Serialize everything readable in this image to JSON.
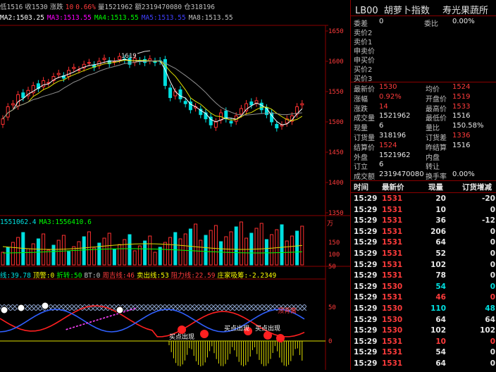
{
  "top_bar": {
    "fragments": [
      {
        "text": "低1516",
        "color": "#c0c0c0"
      },
      {
        "text": "收1530",
        "color": "#c0c0c0"
      },
      {
        "text": "涨跌",
        "color": "#c0c0c0"
      },
      {
        "text": "10",
        "color": "#ff3b3b"
      },
      {
        "text": "0.66%",
        "color": "#ff3b3b"
      },
      {
        "text": "量1521962",
        "color": "#c0c0c0"
      },
      {
        "text": "额2319470080",
        "color": "#c0c0c0"
      },
      {
        "text": "仓318196",
        "color": "#c0c0c0"
      }
    ]
  },
  "ma_line": {
    "fragments": [
      {
        "text": "MA2:1503.25",
        "color": "#ffffff"
      },
      {
        "text": "MA3:1513.55",
        "color": "#ff00ff"
      },
      {
        "text": "MA4:1513.55",
        "color": "#00ff00"
      },
      {
        "text": "MA5:1513.55",
        "color": "#4040ff"
      },
      {
        "text": "MA8:1513.55",
        "color": "#c0c0c0"
      }
    ]
  },
  "price_axis": [
    "1650",
    "1600",
    "1550",
    "1500",
    "1450",
    "1400",
    "1350"
  ],
  "peak_label": "1619",
  "volume_bar": {
    "fragments": [
      {
        "text": "1551062.4",
        "color": "#00e0e0"
      },
      {
        "text": "MA3:1556410.6",
        "color": "#00ff00"
      }
    ]
  },
  "volume_axis": [
    "150",
    "100",
    "50"
  ],
  "volume_unit": "万",
  "indicator_bar": {
    "fragments": [
      {
        "text": "线:39.78",
        "color": "#00e0e0"
      },
      {
        "text": "顶警:0",
        "color": "#ffff00"
      },
      {
        "text": "折转:50",
        "color": "#00ff00"
      },
      {
        "text": "BT:0",
        "color": "#c0c0c0"
      },
      {
        "text": "周吉线:46",
        "color": "#ff3b3b"
      },
      {
        "text": "卖出线:53",
        "color": "#ffff00"
      },
      {
        "text": "阻力线:22.59",
        "color": "#ff3b3b"
      },
      {
        "text": "庄家吸筹:-2.2349",
        "color": "#ffff00"
      }
    ]
  },
  "indicator_axis": [
    "50",
    "0"
  ],
  "annotations": {
    "sell_top": "顶背离",
    "buy_1": "买点出现",
    "buy_2": "买点出现",
    "buy_3": "买点出现"
  },
  "right_panel": {
    "code": "LB00",
    "name": "胡萝卜指数",
    "sub": "寿光果蔬所",
    "book": [
      {
        "label": "委差",
        "value": "0",
        "label2": "委比",
        "value2": "0.00%"
      },
      {
        "label": "卖价2",
        "value": ""
      },
      {
        "label": "卖价1",
        "value": ""
      },
      {
        "label": "申卖价",
        "value": ""
      },
      {
        "label": "申买价",
        "value": ""
      },
      {
        "label": "买价2",
        "value": ""
      },
      {
        "label": "买价3",
        "value": ""
      }
    ],
    "quote": [
      {
        "l1": "最新价",
        "v1": "1530",
        "c1": "red",
        "l2": "均价",
        "v2": "1524",
        "c2": "red"
      },
      {
        "l1": "涨幅",
        "v1": "0.92%",
        "c1": "red",
        "l2": "开盘价",
        "v2": "1519",
        "c2": "red"
      },
      {
        "l1": "涨跌",
        "v1": "14",
        "c1": "red",
        "l2": "最高价",
        "v2": "1533",
        "c2": "red"
      },
      {
        "l1": "成交量",
        "v1": "1521962",
        "c1": "white",
        "l2": "最低价",
        "v2": "1516",
        "c2": "white"
      },
      {
        "l1": "现量",
        "v1": "6",
        "c1": "white",
        "l2": "量比",
        "v2": "150.58%",
        "c2": "white"
      },
      {
        "l1": "订货量",
        "v1": "318196",
        "c1": "white",
        "l2": "订货差",
        "v2": "1336",
        "c2": "red"
      },
      {
        "l1": "结算价",
        "v1": "1524",
        "c1": "red",
        "l2": "昨结算",
        "v2": "1516",
        "c2": "white"
      },
      {
        "l1": "外盘",
        "v1": "1521962",
        "c1": "white",
        "l2": "内盘",
        "v2": "",
        "c2": "white"
      },
      {
        "l1": "订立",
        "v1": "6",
        "c1": "white",
        "l2": "转让",
        "v2": "",
        "c2": "white"
      },
      {
        "l1": "成交额",
        "v1": "2319470080",
        "c1": "white",
        "l2": "换手率",
        "v2": "0.00%",
        "c2": "white"
      }
    ],
    "tick_headers": [
      "时间",
      "最新价",
      "现量",
      "订货增减"
    ],
    "ticks": [
      {
        "time": "15:29",
        "price": "1531",
        "pc": "red",
        "vol": "20",
        "vc": "white",
        "chg": "-20",
        "cc": "white"
      },
      {
        "time": "15:29",
        "price": "1531",
        "pc": "red",
        "vol": "10",
        "vc": "white",
        "chg": "0",
        "cc": "white"
      },
      {
        "time": "15:29",
        "price": "1531",
        "pc": "red",
        "vol": "36",
        "vc": "white",
        "chg": "-12",
        "cc": "white"
      },
      {
        "time": "15:29",
        "price": "1531",
        "pc": "red",
        "vol": "206",
        "vc": "white",
        "chg": "0",
        "cc": "white"
      },
      {
        "time": "15:29",
        "price": "1531",
        "pc": "red",
        "vol": "64",
        "vc": "white",
        "chg": "0",
        "cc": "white"
      },
      {
        "time": "15:29",
        "price": "1531",
        "pc": "red",
        "vol": "52",
        "vc": "white",
        "chg": "0",
        "cc": "white"
      },
      {
        "time": "15:29",
        "price": "1531",
        "pc": "red",
        "vol": "102",
        "vc": "white",
        "chg": "0",
        "cc": "white"
      },
      {
        "time": "15:29",
        "price": "1531",
        "pc": "red",
        "vol": "78",
        "vc": "white",
        "chg": "0",
        "cc": "white"
      },
      {
        "time": "15:29",
        "price": "1530",
        "pc": "red",
        "vol": "54",
        "vc": "cyan",
        "chg": "0",
        "cc": "cyan"
      },
      {
        "time": "15:29",
        "price": "1531",
        "pc": "red",
        "vol": "46",
        "vc": "red",
        "chg": "0",
        "cc": "red"
      },
      {
        "time": "15:29",
        "price": "1530",
        "pc": "red",
        "vol": "110",
        "vc": "cyan",
        "chg": "48",
        "cc": "cyan"
      },
      {
        "time": "15:29",
        "price": "1530",
        "pc": "red",
        "vol": "64",
        "vc": "white",
        "chg": "64",
        "cc": "white"
      },
      {
        "time": "15:29",
        "price": "1530",
        "pc": "red",
        "vol": "102",
        "vc": "white",
        "chg": "102",
        "cc": "white"
      },
      {
        "time": "15:29",
        "price": "1531",
        "pc": "red",
        "vol": "10",
        "vc": "red",
        "chg": "0",
        "cc": "red"
      },
      {
        "time": "15:29",
        "price": "1531",
        "pc": "red",
        "vol": "54",
        "vc": "white",
        "chg": "0",
        "cc": "white"
      },
      {
        "time": "15:29",
        "price": "1531",
        "pc": "red",
        "vol": "64",
        "vc": "white",
        "chg": "0",
        "cc": "white"
      }
    ]
  }
}
